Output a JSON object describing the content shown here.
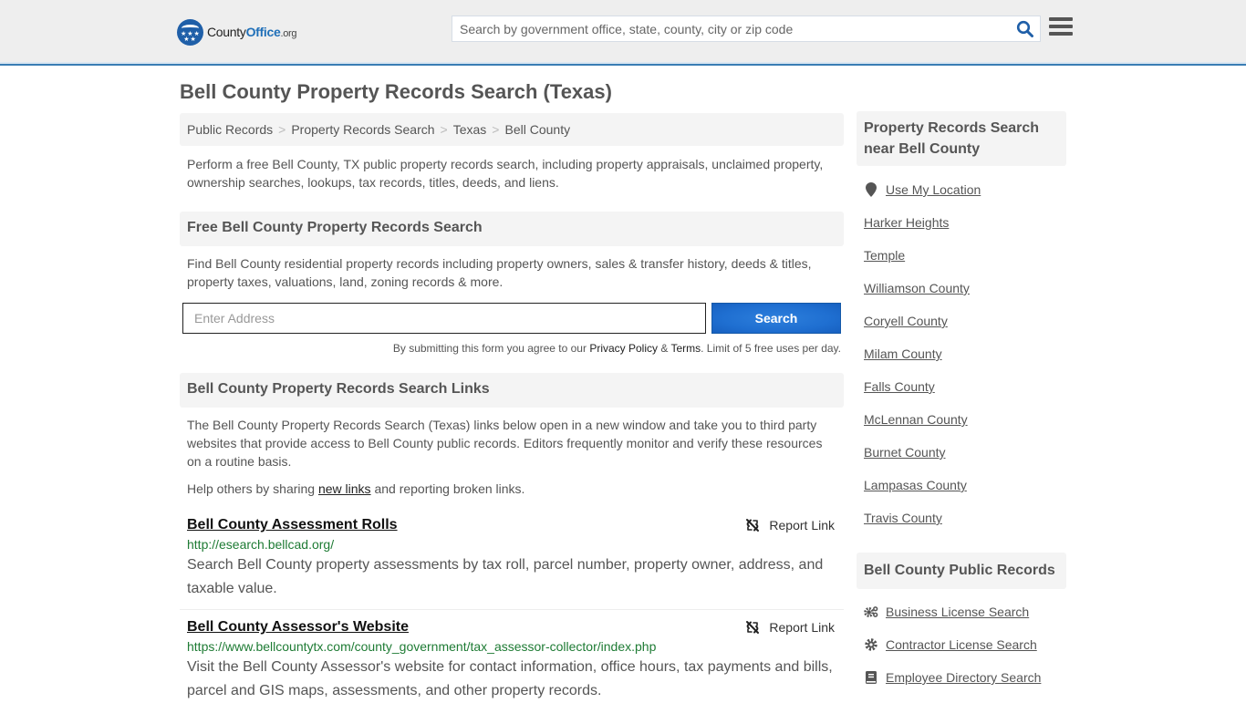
{
  "header": {
    "logo": {
      "brand_prefix": "County",
      "brand_main": "Office",
      "brand_suffix": ".org"
    },
    "search": {
      "placeholder": "Search by government office, state, county, city or zip code",
      "value": ""
    },
    "icons": {
      "search": "search-icon",
      "menu": "hamburger-menu-icon"
    }
  },
  "page": {
    "title": "Bell County Property Records Search (Texas)"
  },
  "breadcrumb": [
    {
      "label": "Public Records"
    },
    {
      "label": "Property Records Search"
    },
    {
      "label": "Texas"
    },
    {
      "label": "Bell County"
    }
  ],
  "breadcrumb_separator": ">",
  "intro": "Perform a free Bell County, TX public property records search, including property appraisals, unclaimed property, ownership searches, lookups, tax records, titles, deeds, and liens.",
  "free_search": {
    "heading": "Free Bell County Property Records Search",
    "description": "Find Bell County residential property records including property owners, sales & transfer history, deeds & titles, property taxes, valuations, land, zoning records & more.",
    "address_placeholder": "Enter Address",
    "address_value": "",
    "button_label": "Search",
    "terms_prefix": "By submitting this form you agree to our ",
    "privacy_label": "Privacy Policy",
    "terms_amp": " & ",
    "terms_label": "Terms",
    "terms_suffix": ". Limit of 5 free uses per day."
  },
  "links_section": {
    "heading": "Bell County Property Records Search Links",
    "description": "The Bell County Property Records Search (Texas) links below open in a new window and take you to third party websites that provide access to Bell County public records. Editors frequently monitor and verify these resources on a routine basis.",
    "help_prefix": "Help others by sharing ",
    "help_link": "new links",
    "help_suffix": " and reporting broken links.",
    "report_label": "Report Link",
    "items": [
      {
        "title": "Bell County Assessment Rolls",
        "url": "http://esearch.bellcad.org/",
        "description": "Search Bell County property assessments by tax roll, parcel number, property owner, address, and taxable value."
      },
      {
        "title": "Bell County Assessor's Website",
        "url": "https://www.bellcountytx.com/county_government/tax_assessor-collector/index.php",
        "description": "Visit the Bell County Assessor's website for contact information, office hours, tax payments and bills, parcel and GIS maps, assessments, and other property records."
      }
    ]
  },
  "sidebar": {
    "nearby": {
      "heading": "Property Records Search near Bell County",
      "use_location": "Use My Location",
      "items": [
        "Harker Heights",
        "Temple",
        "Williamson County",
        "Coryell County",
        "Milam County",
        "Falls County",
        "McLennan County",
        "Burnet County",
        "Lampasas County",
        "Travis County"
      ]
    },
    "public_records": {
      "heading": "Bell County Public Records",
      "items": [
        {
          "label": "Business License Search",
          "icon": "cogs-icon"
        },
        {
          "label": "Contractor License Search",
          "icon": "gear-icon"
        },
        {
          "label": "Employee Directory Search",
          "icon": "book-icon"
        }
      ]
    }
  },
  "colors": {
    "header_bg": "#eeeeee",
    "header_border": "#3a7db4",
    "brand_blue": "#1f6fb8",
    "button_blue": "#1f6fd1",
    "url_green": "#1e7b34",
    "text": "#555555",
    "panel_bg": "#f4f4f4"
  }
}
